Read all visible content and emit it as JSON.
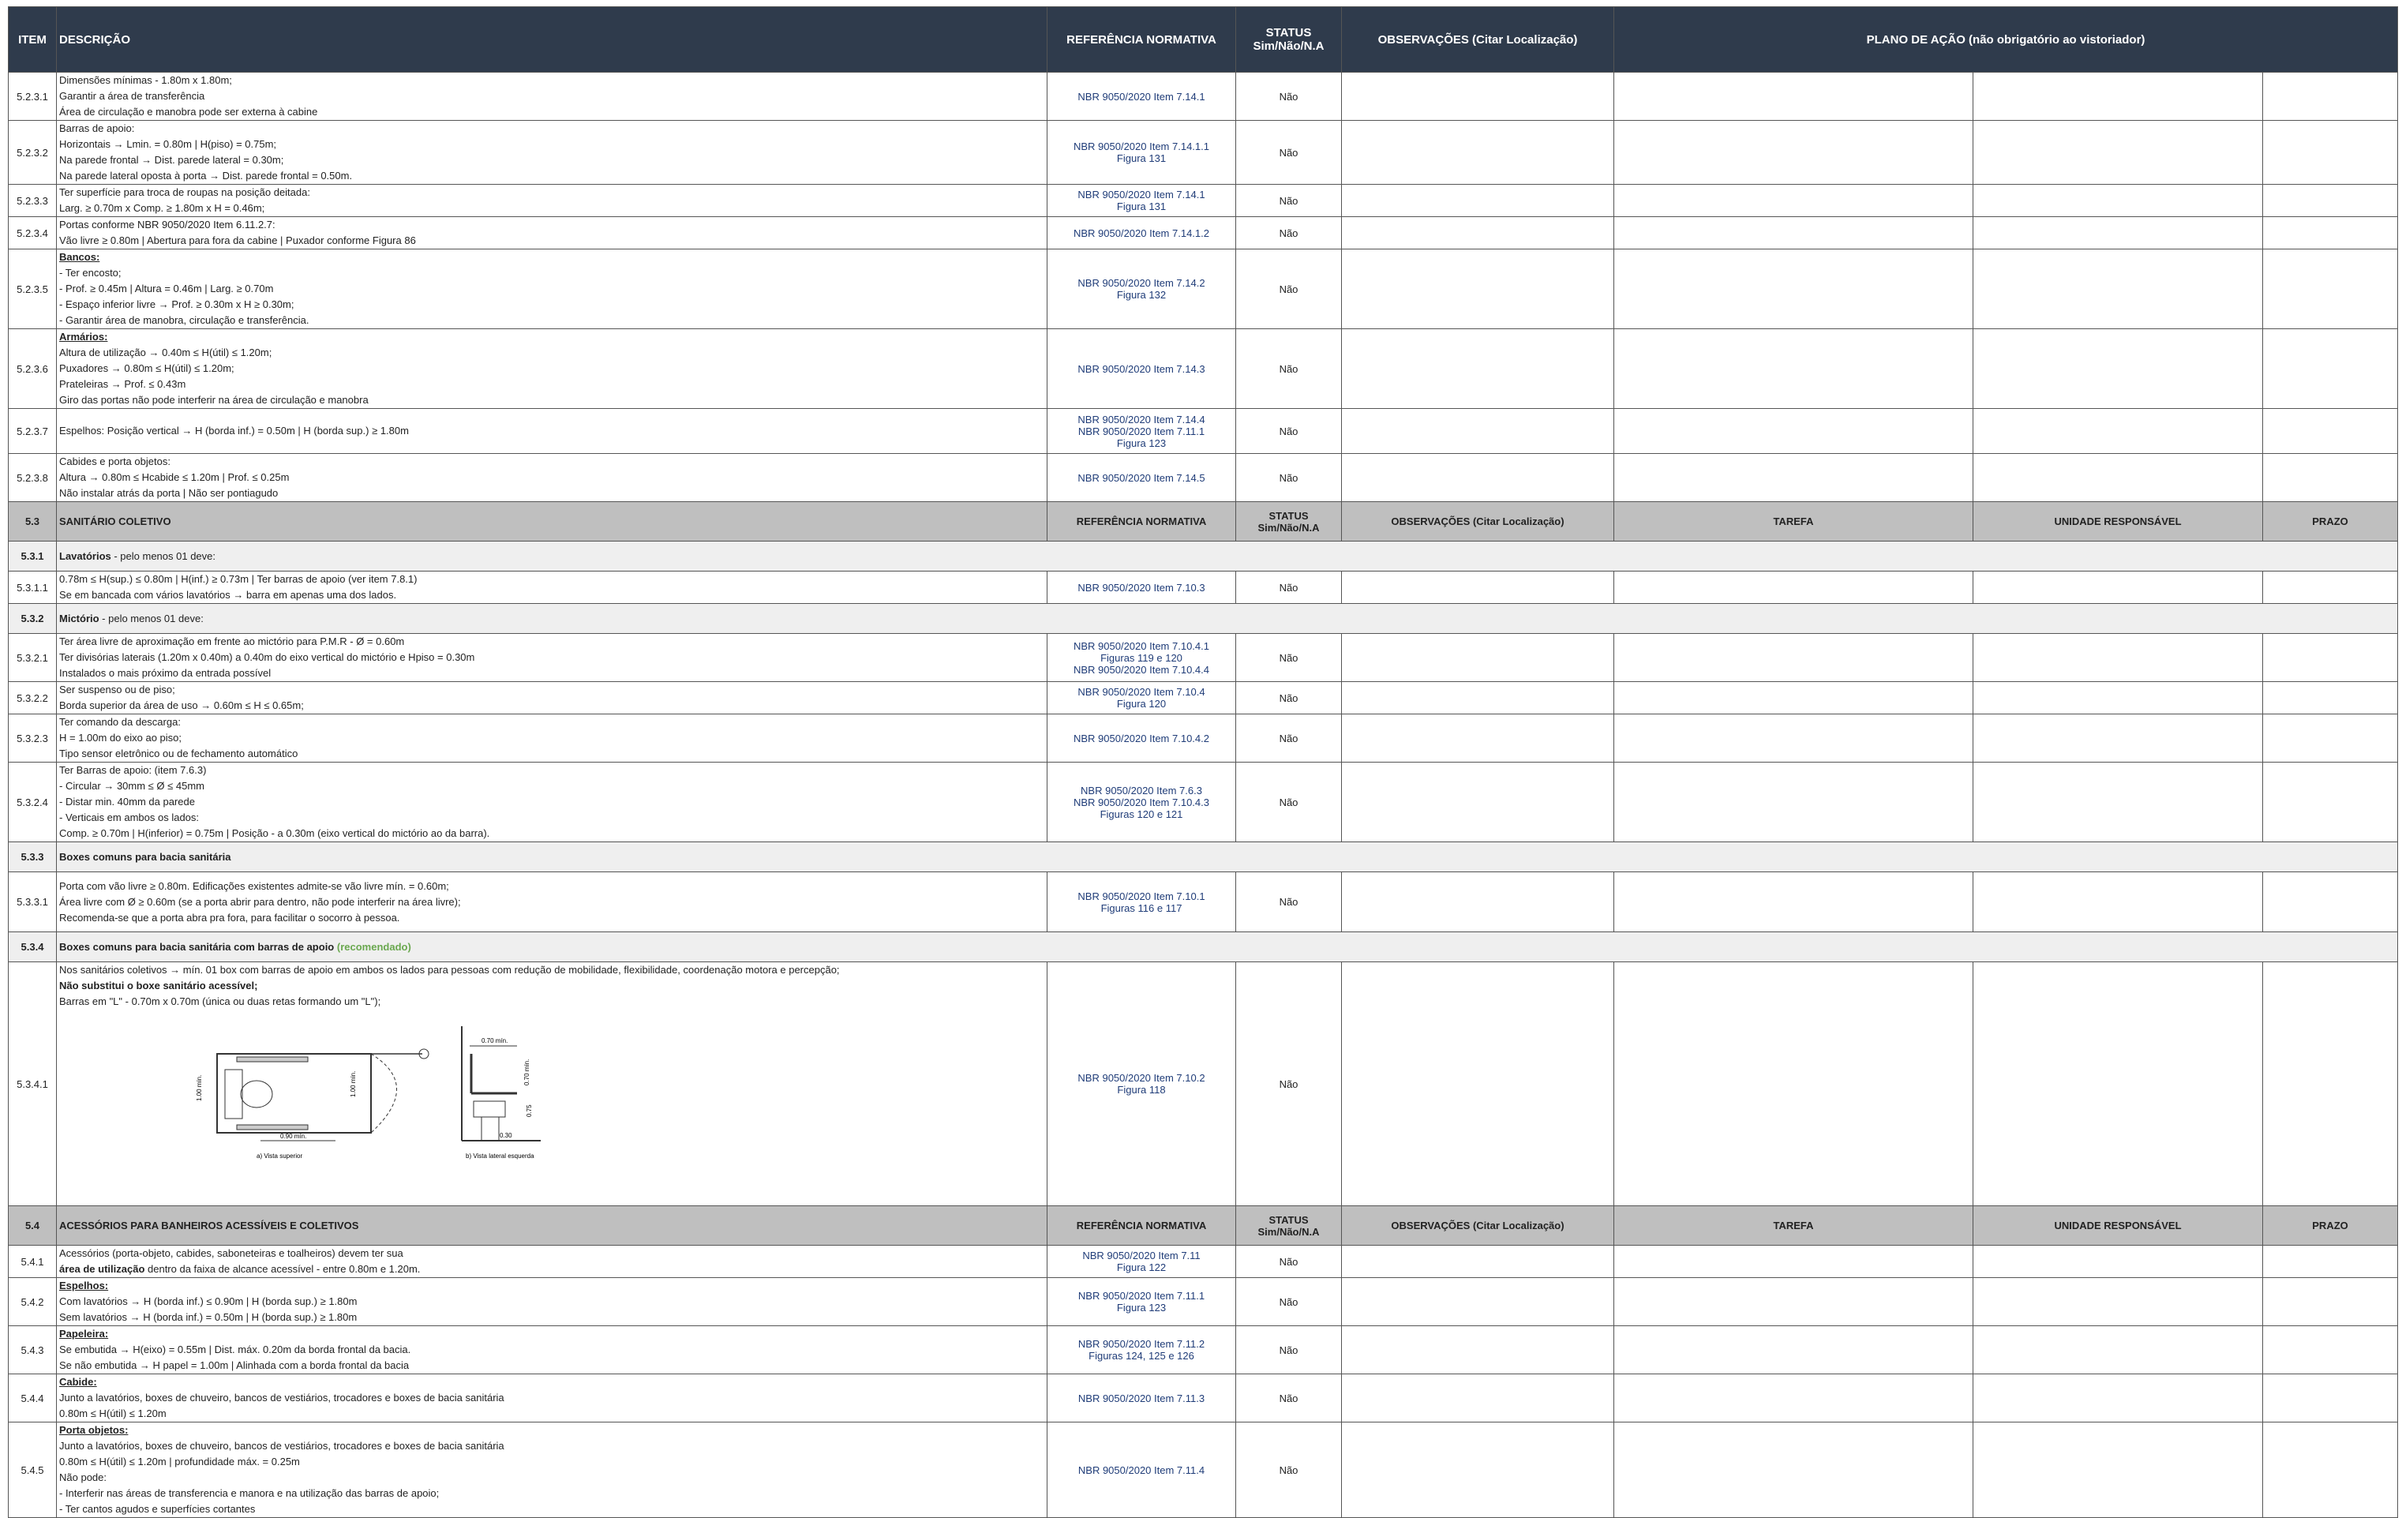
{
  "header": {
    "item": "ITEM",
    "descricao": "DESCRIÇÃO",
    "referencia": "REFERÊNCIA NORMATIVA",
    "status_l1": "STATUS",
    "status_l2": "Sim/Não/N.A",
    "observacoes": "OBSERVAÇÕES (Citar Localização)",
    "plano": "PLANO DE AÇÃO (não obrigatório ao vistoriador)"
  },
  "sec_cols": {
    "referencia": "REFERÊNCIA NORMATIVA",
    "status_l1": "STATUS",
    "status_l2": "Sim/Não/N.A",
    "observacoes": "OBSERVAÇÕES (Citar Localização)",
    "tarefa": "TAREFA",
    "unidade": "UNIDADE RESPONSÁVEL",
    "prazo": "PRAZO"
  },
  "rows_a": [
    {
      "item": "5.2.3.1",
      "lines": [
        "Dimensões mínimas - 1.80m x 1.80m;",
        "Garantir a área de transferência",
        "Área de circulação e manobra pode ser externa à cabine"
      ],
      "ref": [
        "NBR 9050/2020 Item 7.14.1"
      ],
      "status": "Não"
    },
    {
      "item": "5.2.3.2",
      "lines": [
        "Barras de apoio:",
        "Horizontais → Lmin. = 0.80m | H(piso) = 0.75m;",
        "Na parede frontal → Dist. parede lateral = 0.30m;",
        "Na parede lateral oposta à porta → Dist. parede frontal = 0.50m."
      ],
      "ref": [
        "NBR 9050/2020 Item 7.14.1.1",
        "Figura 131"
      ],
      "status": "Não"
    },
    {
      "item": "5.2.3.3",
      "lines": [
        "Ter superfície para troca de roupas na posição deitada:",
        "Larg. ≥ 0.70m x Comp. ≥ 1.80m x H = 0.46m;"
      ],
      "ref": [
        "NBR 9050/2020 Item 7.14.1",
        "Figura 131"
      ],
      "status": "Não"
    },
    {
      "item": "5.2.3.4",
      "lines": [
        "Portas conforme NBR 9050/2020 Item 6.11.2.7:",
        "Vão livre ≥ 0.80m | Abertura para fora da cabine | Puxador conforme Figura 86"
      ],
      "ref": [
        "NBR 9050/2020 Item 7.14.1.2"
      ],
      "status": "Não"
    },
    {
      "item": "5.2.3.5",
      "title": "Bancos:",
      "lines": [
        "- Ter encosto;",
        "- Prof. ≥ 0.45m | Altura = 0.46m | Larg. ≥ 0.70m",
        "- Espaço inferior livre → Prof. ≥ 0.30m x  H ≥ 0.30m;",
        "- Garantir área de manobra, circulação e transferência."
      ],
      "ref": [
        "NBR 9050/2020 Item 7.14.2",
        "Figura 132"
      ],
      "status": "Não"
    },
    {
      "item": "5.2.3.6",
      "title": "Armários:",
      "lines": [
        "Altura de utilização → 0.40m ≤ H(útil) ≤ 1.20m;",
        "Puxadores → 0.80m ≤ H(útil) ≤ 1.20m;",
        "Prateleiras → Prof. ≤ 0.43m",
        "Giro das portas não pode interferir na área de circulação e manobra"
      ],
      "ref": [
        "NBR 9050/2020 Item 7.14.3"
      ],
      "status": "Não"
    },
    {
      "item": "5.2.3.7",
      "lines": [
        "Espelhos: Posição vertical → H (borda inf.) = 0.50m | H (borda sup.) ≥ 1.80m"
      ],
      "ref": [
        "NBR 9050/2020 Item 7.14.4",
        "NBR 9050/2020 Item 7.11.1",
        "Figura 123"
      ],
      "status": "Não"
    },
    {
      "item": "5.2.3.8",
      "lines": [
        "Cabides e porta objetos:",
        "Altura → 0.80m ≤ Hcabide ≤ 1.20m | Prof. ≤ 0.25m",
        "Não instalar atrás da porta | Não ser pontiagudo"
      ],
      "ref": [
        "NBR 9050/2020 Item 7.14.5"
      ],
      "status": "Não"
    }
  ],
  "sec_53": {
    "num": "5.3",
    "title": "SANITÁRIO COLETIVO"
  },
  "sub_531": {
    "num": "5.3.1",
    "title": "Lavatórios",
    "rest": " - pelo menos 01 deve:"
  },
  "row_5311": {
    "item": "5.3.1.1",
    "lines": [
      "0.78m ≤ H(sup.) ≤ 0.80m | H(inf.) ≥ 0.73m | Ter barras de apoio (ver item 7.8.1)",
      "Se em bancada com vários lavatórios → barra em apenas uma dos lados."
    ],
    "ref": [
      "NBR 9050/2020 Item 7.10.3"
    ],
    "status": "Não"
  },
  "sub_532": {
    "num": "5.3.2",
    "title": "Mictório",
    "rest": " - pelo menos 01 deve:"
  },
  "rows_532": [
    {
      "item": "5.3.2.1",
      "lines": [
        "Ter área livre de aproximação em frente ao mictório para P.M.R - Ø = 0.60m",
        "Ter divisórias laterais (1.20m x 0.40m) a 0.40m do eixo vertical do mictório e Hpiso = 0.30m",
        "Instalados o mais próximo da entrada possível"
      ],
      "ref": [
        "NBR 9050/2020 Item 7.10.4.1",
        "Figuras 119 e 120",
        "NBR 9050/2020 Item 7.10.4.4"
      ],
      "status": "Não"
    },
    {
      "item": "5.3.2.2",
      "lines": [
        "Ser suspenso ou de piso;",
        "Borda superior da área de uso → 0.60m ≤ H ≤ 0.65m;"
      ],
      "ref": [
        "NBR 9050/2020 Item 7.10.4",
        "Figura 120"
      ],
      "status": "Não"
    },
    {
      "item": "5.3.2.3",
      "lines": [
        "Ter comando da descarga:",
        "H = 1.00m do eixo ao piso;",
        "Tipo sensor eletrônico ou de fechamento automático"
      ],
      "ref": [
        "NBR 9050/2020 Item 7.10.4.2"
      ],
      "status": "Não"
    },
    {
      "item": "5.3.2.4",
      "lines": [
        "Ter Barras de apoio: (item 7.6.3)",
        "- Circular → 30mm ≤ Ø ≤ 45mm",
        "- Distar min. 40mm da parede",
        "- Verticais em ambos os lados:",
        "Comp. ≥ 0.70m | H(inferior) = 0.75m | Posição - a 0.30m (eixo vertical do mictório ao da barra)."
      ],
      "ref": [
        "NBR 9050/2020 Item 7.6.3",
        "NBR 9050/2020 Item 7.10.4.3",
        "Figuras 120 e 121"
      ],
      "status": "Não"
    }
  ],
  "sub_533": {
    "num": "5.3.3",
    "title": "Boxes comuns para bacia sanitária"
  },
  "row_5331": {
    "item": "5.3.3.1",
    "lines": [
      "Porta com vão livre ≥ 0.80m. Edificações existentes admite-se vão livre mín. = 0.60m;",
      "Área livre com Ø ≥ 0.60m (se a porta abrir para dentro, não pode interferir na área livre);",
      "Recomenda-se que a porta abra pra fora, para facilitar o socorro à pessoa."
    ],
    "ref": [
      "NBR 9050/2020 Item 7.10.1",
      "Figuras 116 e 117"
    ],
    "status": "Não"
  },
  "sub_534": {
    "num": "5.3.4",
    "title": "Boxes comuns para bacia sanitária com barras de apoio",
    "rec": "(recomendado)"
  },
  "row_5341": {
    "item": "5.3.4.1",
    "line1": "Nos sanitários coletivos → mín. 01 box com barras de apoio em ambos os lados para pessoas com redução de mobilidade, flexibilidade, coordenação motora e percepção;",
    "line2": "Não substitui o boxe sanitário acessível;",
    "line3": "Barras em \"L\" - 0.70m x 0.70m (única ou duas retas formando um \"L\");",
    "ref": [
      "NBR 9050/2020 Item 7.10.2",
      "Figura 118"
    ],
    "status": "Não",
    "fig": {
      "dim_a": "0.90 mín.",
      "dim_b": "1.00 mín.",
      "dim_c": "0.70 mín.",
      "dim_d": "0.70 mín.",
      "dim_e": "0.75",
      "dim_f": "0.30",
      "cap_a": "a) Vista superior",
      "cap_b": "b) Vista lateral esquerda"
    }
  },
  "sec_54": {
    "num": "5.4",
    "title": "ACESSÓRIOS PARA BANHEIROS ACESSÍVEIS E COLETIVOS"
  },
  "row_541": {
    "item": "5.4.1",
    "l1": "Acessórios (porta-objeto, cabides, saboneteiras e toalheiros) devem ter sua",
    "l2b": "área de utilização",
    "l2r": " dentro da faixa de alcance acessível - entre 0.80m e 1.20m.",
    "ref": [
      "NBR 9050/2020 Item 7.11",
      "Figura 122"
    ],
    "status": "Não"
  },
  "rows_54": [
    {
      "item": "5.4.2",
      "title": "Espelhos:",
      "lines": [
        "Com lavatórios → H (borda inf.) ≤ 0.90m | H (borda sup.) ≥ 1.80m",
        "Sem lavatórios → H (borda inf.) = 0.50m | H (borda sup.) ≥ 1.80m"
      ],
      "ref": [
        "NBR 9050/2020 Item 7.11.1",
        "Figura 123"
      ],
      "status": "Não"
    },
    {
      "item": "5.4.3",
      "title": "Papeleira:",
      "lines": [
        "Se embutida → H(eixo) = 0.55m | Dist. máx. 0.20m da borda frontal da bacia.",
        "Se não embutida → H papel = 1.00m | Alinhada com a borda frontal da bacia"
      ],
      "ref": [
        "NBR 9050/2020 Item 7.11.2",
        "Figuras 124, 125 e 126"
      ],
      "status": "Não"
    },
    {
      "item": "5.4.4",
      "title": "Cabide:",
      "lines": [
        "Junto a lavatórios, boxes de chuveiro, bancos de vestiários, trocadores e boxes de bacia sanitária",
        "0.80m ≤ H(útil) ≤ 1.20m"
      ],
      "ref": [
        "NBR 9050/2020 Item 7.11.3"
      ],
      "status": "Não"
    },
    {
      "item": "5.4.5",
      "title": "Porta objetos:",
      "lines": [
        "Junto a lavatórios, boxes de chuveiro, bancos de vestiários, trocadores e boxes de bacia sanitária",
        "0.80m ≤ H(útil) ≤ 1.20m | profundidade máx. = 0.25m",
        "Não pode:",
        "- Interferir nas áreas de transferencia e manora e na utilização das barras de apoio;",
        "- Ter cantos agudos e superfícies cortantes"
      ],
      "ref": [
        "NBR 9050/2020 Item 7.11.4"
      ],
      "status": "Não"
    }
  ]
}
